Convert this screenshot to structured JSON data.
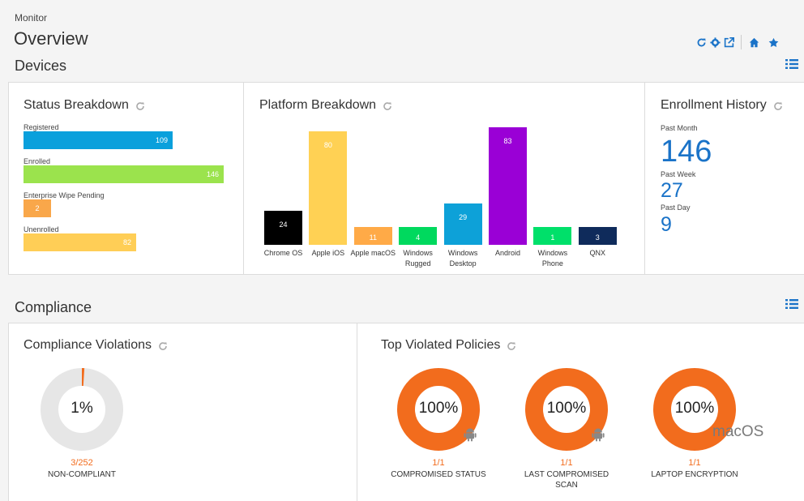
{
  "header": {
    "breadcrumb": "Monitor",
    "title": "Overview",
    "icons": [
      "refresh-icon",
      "gear-icon",
      "external-link-icon",
      "home-icon",
      "star-icon"
    ]
  },
  "devices": {
    "section_title": "Devices",
    "status_breakdown": {
      "title": "Status Breakdown",
      "bars": [
        {
          "label": "Registered",
          "value": 109,
          "color": "#0aa0dc"
        },
        {
          "label": "Enrolled",
          "value": 146,
          "color": "#9be34d"
        },
        {
          "label": "Enterprise Wipe Pending",
          "value": 2,
          "color": "#f9a74a"
        },
        {
          "label": "Unenrolled",
          "value": 82,
          "color": "#ffce56"
        }
      ]
    },
    "platform_breakdown": {
      "title": "Platform Breakdown"
    },
    "enrollment_history": {
      "title": "Enrollment History",
      "items": [
        {
          "label": "Past Month",
          "value": "146"
        },
        {
          "label": "Past Week",
          "value": "27"
        },
        {
          "label": "Past Day",
          "value": "9"
        }
      ]
    }
  },
  "chart_data": {
    "type": "bar",
    "categories": [
      "Chrome OS",
      "Apple iOS",
      "Apple macOS",
      "Windows Rugged",
      "Windows Desktop",
      "Android",
      "Windows Phone",
      "QNX"
    ],
    "values": [
      24,
      80,
      11,
      4,
      29,
      83,
      1,
      3
    ],
    "colors": [
      "#000000",
      "#ffd154",
      "#ffaa47",
      "#00d95e",
      "#0da1d8",
      "#9a00d6",
      "#00e06a",
      "#0f2b5b"
    ],
    "title": "Platform Breakdown"
  },
  "compliance": {
    "section_title": "Compliance",
    "violations": {
      "title": "Compliance Violations",
      "percent_label": "1%",
      "percent": 1,
      "count": "3/252",
      "caption": "NON-COMPLIANT"
    },
    "top_policies": {
      "title": "Top Violated Policies",
      "items": [
        {
          "percent_label": "100%",
          "percent": 100,
          "count": "1/1",
          "caption_line1": "COMPROMISED STATUS",
          "caption_line2": "",
          "badge": "android-icon",
          "badge_text": ""
        },
        {
          "percent_label": "100%",
          "percent": 100,
          "count": "1/1",
          "caption_line1": "LAST COMPROMISED",
          "caption_line2": "SCAN",
          "badge": "android-icon",
          "badge_text": ""
        },
        {
          "percent_label": "100%",
          "percent": 100,
          "count": "1/1",
          "caption_line1": "LAPTOP ENCRYPTION",
          "caption_line2": "",
          "badge": "macos-label",
          "badge_text": "macOS"
        }
      ]
    }
  }
}
